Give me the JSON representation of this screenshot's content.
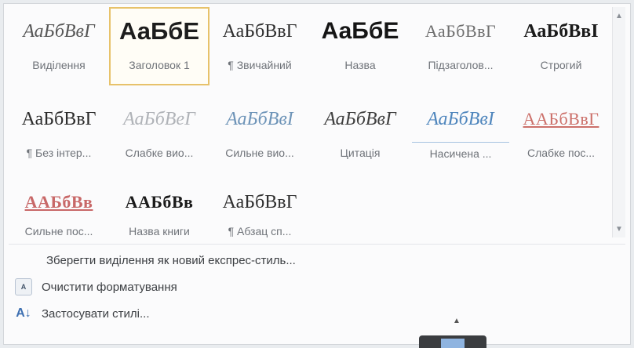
{
  "styles": [
    {
      "sample": "АаБбВвГ",
      "label": "Виділення",
      "key": "s-vydilennia"
    },
    {
      "sample": "АаБбЕ",
      "label": "Заголовок 1",
      "key": "s-zag1"
    },
    {
      "sample": "АаБбВвГ",
      "label": "¶ Звичайний",
      "key": "s-zvych"
    },
    {
      "sample": "АаБбЕ",
      "label": "Назва",
      "key": "s-nazva"
    },
    {
      "sample": "АаБбВвГ",
      "label": "Підзаголов...",
      "key": "s-pidzag"
    },
    {
      "sample": "АаБбВвІ",
      "label": "Строгий",
      "key": "s-strogyi"
    },
    {
      "sample": "АаБбВвГ",
      "label": "¶ Без інтер...",
      "key": "s-bez"
    },
    {
      "sample": "АаБбВеГ",
      "label": "Слабке вио...",
      "key": "s-slabe-vyd"
    },
    {
      "sample": "АаБбВвІ",
      "label": "Сильне вио...",
      "key": "s-sylne-vyd"
    },
    {
      "sample": "АаБбВвГ",
      "label": "Цитація",
      "key": "s-tsytata"
    },
    {
      "sample": "АаБбВвІ",
      "label": "Насичена ...",
      "key": "s-nasychena"
    },
    {
      "sample": "ААБбВвГ",
      "label": "Слабке пос...",
      "key": "s-slabe-pos"
    },
    {
      "sample": "ААБбВв",
      "label": "Сильне пос...",
      "key": "s-sylne-pos"
    },
    {
      "sample": "ААБбВв",
      "label": "Назва книги",
      "key": "s-nazva-knygy"
    },
    {
      "sample": "АаБбВвГ",
      "label": "¶ Абзац сп...",
      "key": "s-abzats"
    }
  ],
  "selected_index": 1,
  "actions": {
    "save_selection": "Зберегти виділення як новий експрес-стиль...",
    "clear_formatting": "Очистити форматування",
    "apply_styles": "Застосувати стилі..."
  },
  "icons": {
    "clear_formatting": "clear-formatting-icon",
    "apply_styles": "apply-styles-icon"
  }
}
